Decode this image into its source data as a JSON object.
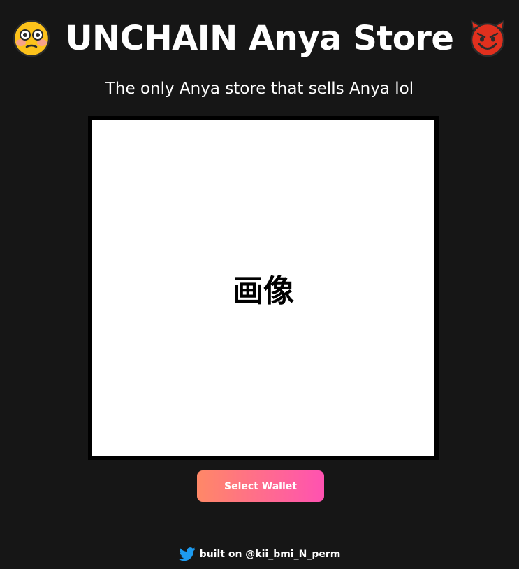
{
  "header": {
    "title": "UNCHAIN Anya Store",
    "left_icon": "flushed-face-icon",
    "right_icon": "smiling-devil-icon"
  },
  "subtitle": "The only Anya store that sells Anya lol",
  "image_placeholder": {
    "text": "画像"
  },
  "wallet_button": {
    "label": "Select Wallet"
  },
  "footer": {
    "icon": "twitter-icon",
    "text": "built on @kii_bmi_N_perm"
  },
  "colors": {
    "background": "#161616",
    "text": "#ffffff",
    "button_gradient_start": "#ff8867",
    "button_gradient_end": "#ff52b1",
    "twitter_blue": "#1d9bf0"
  }
}
